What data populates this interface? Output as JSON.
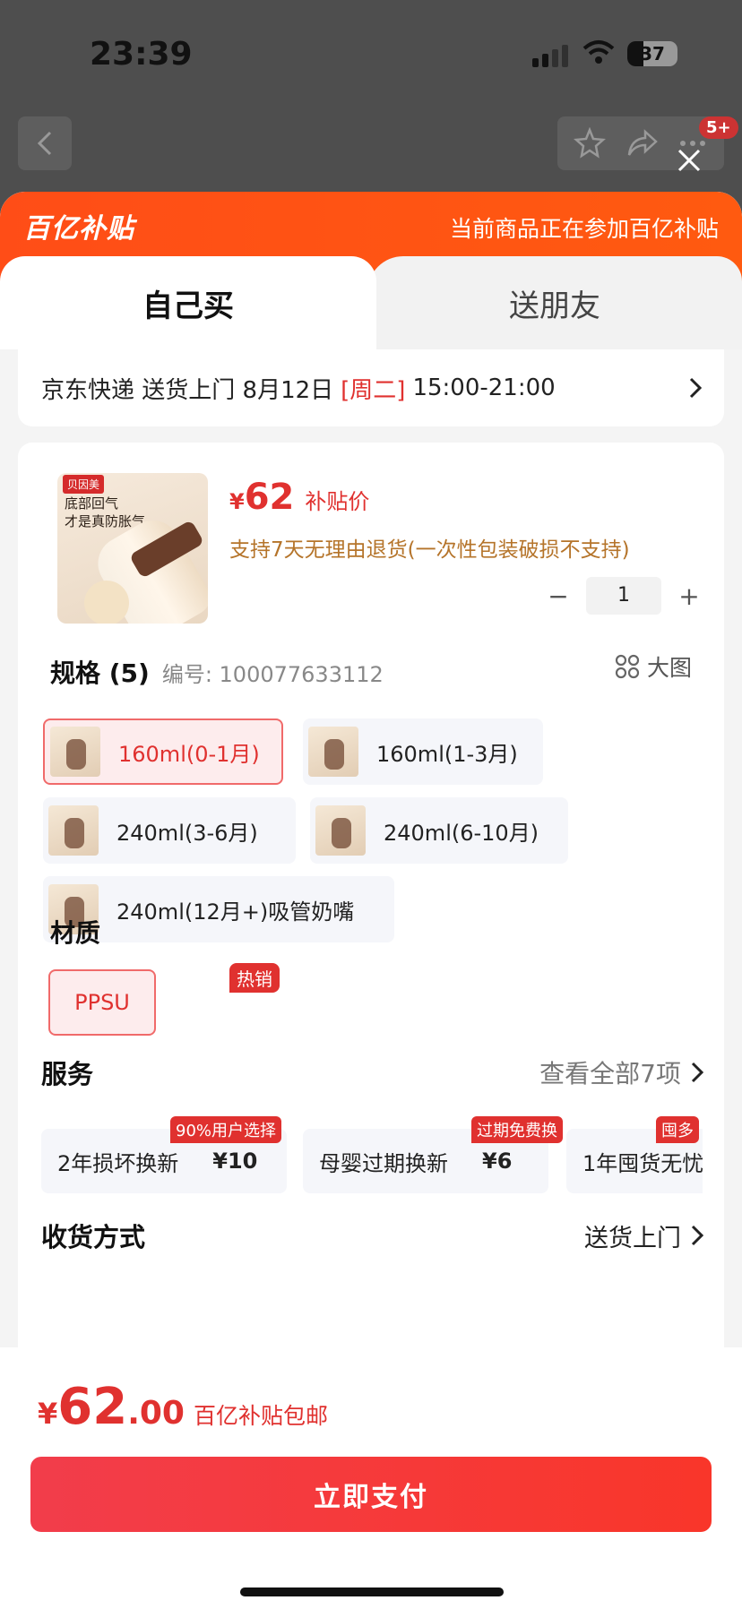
{
  "status_bar": {
    "time": "23:39",
    "battery": "37"
  },
  "top_nav": {
    "cart_badge": "5+"
  },
  "promo": {
    "logo": "百亿补贴",
    "text": "当前商品正在参加百亿补贴"
  },
  "tabs": [
    {
      "label": "自己买"
    },
    {
      "label": "送朋友"
    }
  ],
  "delivery": {
    "prefix": "京东快递 送货上门 8月12日",
    "weekday": "[周二]",
    "time_range": "15:00-21:00"
  },
  "product": {
    "image_brand": "贝因美",
    "image_caption_line1": "底部回气",
    "image_caption_line2": "才是真防胀气",
    "currency": "¥",
    "price": "62",
    "price_label": "补贴价",
    "return_note": "支持7天无理由退货(一次性包装破损不支持)",
    "quantity": "1",
    "qty_minus": "−",
    "qty_plus": "+"
  },
  "spec": {
    "title": "规格 (5)",
    "code": "编号: 100077633112",
    "big_image_label": "大图",
    "hot_tag": "热销",
    "options": [
      {
        "label": "160ml(0-1月)"
      },
      {
        "label": "160ml(1-3月)"
      },
      {
        "label": "240ml(3-6月)"
      },
      {
        "label": "240ml(6-10月)"
      },
      {
        "label": "240ml(12月+)吸管奶嘴"
      }
    ]
  },
  "material": {
    "title": "材质",
    "option": "PPSU"
  },
  "services": {
    "title": "服务",
    "more": "查看全部7项",
    "items": [
      {
        "tag": "90%用户选择",
        "name": "2年损坏换新",
        "price": "¥10"
      },
      {
        "tag": "过期免费换",
        "name": "母婴过期换新",
        "price": "¥6"
      },
      {
        "tag": "囤多",
        "name": "1年囤货无忧",
        "price": ""
      }
    ]
  },
  "shipping": {
    "title": "收货方式",
    "value": "送货上门"
  },
  "footer": {
    "currency": "¥",
    "total_int": "62",
    "total_dec": ".00",
    "total_label": "百亿补贴包邮",
    "pay_label": "立即支付"
  },
  "colors": {
    "accent": "#e0312f",
    "promo": "#ff4d17",
    "note": "#b5742a"
  }
}
